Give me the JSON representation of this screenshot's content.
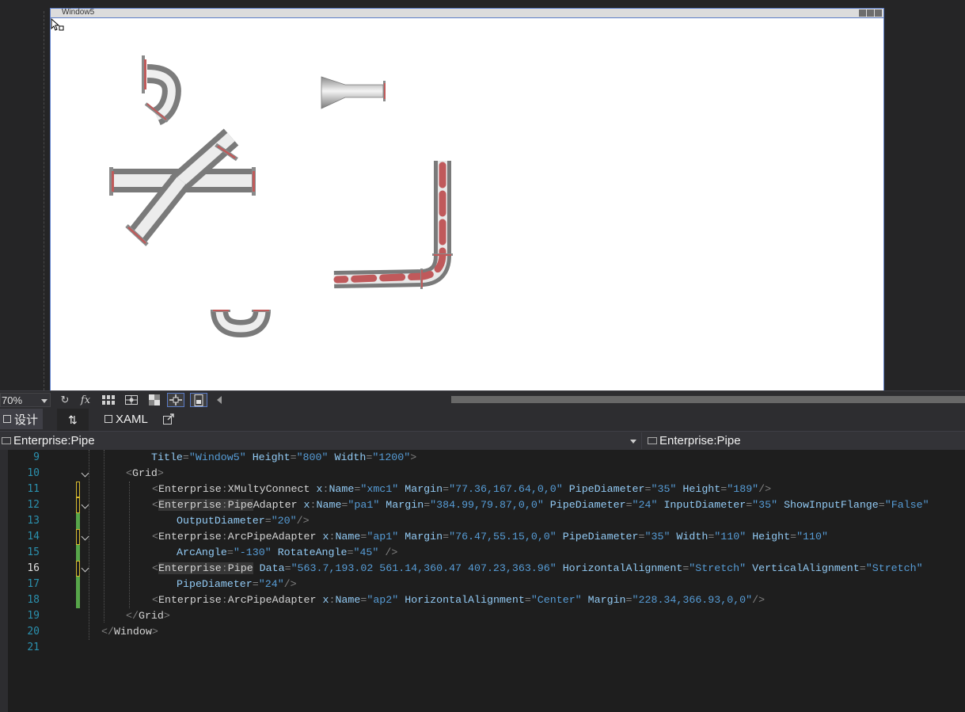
{
  "window": {
    "title": "Window5"
  },
  "toolbar": {
    "zoom": "70%",
    "fx_label": "fx"
  },
  "tabs": {
    "design": "设计",
    "swap_icon": "swap-panes-icon",
    "xaml": "XAML"
  },
  "nav": {
    "left": "Enterprise:Pipe",
    "right": "Enterprise:Pipe"
  },
  "editor": {
    "line_numbers": [
      "9",
      "10",
      "11",
      "12",
      "13",
      "14",
      "15",
      "16",
      "17",
      "18",
      "19",
      "20",
      "21"
    ],
    "lines": [
      "Title=\"Window5\" Height=\"800\" Width=\"1200\">",
      "<Grid>",
      "<Enterprise:XMultyConnect x:Name=\"xmc1\" Margin=\"77.36,167.64,0,0\" PipeDiameter=\"35\" Height=\"189\"/>",
      "<Enterprise:PipeAdapter x:Name=\"pa1\" Margin=\"384.99,79.87,0,0\" PipeDiameter=\"24\" InputDiameter=\"35\" ShowInputFlange=\"False\"",
      "OutputDiameter=\"20\"/>",
      "<Enterprise:ArcPipeAdapter x:Name=\"ap1\" Margin=\"76.47,55.15,0,0\" PipeDiameter=\"35\" Width=\"110\" Height=\"110\"",
      "ArcAngle=\"-130\" RotateAngle=\"45\" />",
      "<Enterprise:Pipe Data=\"563.7,193.02 561.14,360.47 407.23,363.96\" HorizontalAlignment=\"Stretch\" VerticalAlignment=\"Stretch\"",
      "PipeDiameter=\"24\"/>",
      "<Enterprise:ArcPipeAdapter x:Name=\"ap2\" HorizontalAlignment=\"Center\" Margin=\"228.34,366.93,0,0\"/>",
      "</Grid>",
      "</Window>",
      ""
    ]
  },
  "colors": {
    "pipe_body": "#c8c8c8",
    "pipe_flow": "#c0595b",
    "selection_border": "#5b7cc7",
    "line_number": "#2b91af",
    "xml_attr": "#92caf4",
    "xml_value": "#569cd6",
    "change_saved": "#57a64a",
    "change_unsaved": "#d7ba2e"
  }
}
